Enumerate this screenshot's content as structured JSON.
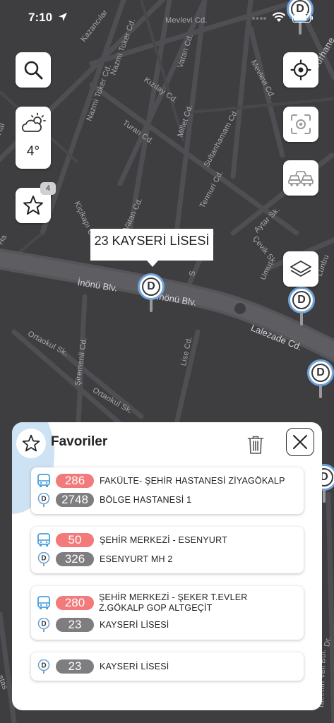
{
  "status_bar": {
    "time": "7:10",
    "icons": [
      "location-arrow-icon",
      "signal-icon",
      "wifi-icon",
      "battery-icon"
    ]
  },
  "map": {
    "streets": [
      "Mevlevi Cd.",
      "Kazancılar",
      "Nazmi Toker Cd.",
      "Nazmi Toker Cd.",
      "Kızılay Cd.",
      "Vatan Cd.",
      "Mevlevi Cd.",
      "Turan Cd.",
      "Millet Cd.",
      "Sultanhamam Cd.",
      "Tennuri Cd.",
      "Kiçikapı Cd.",
      "Vatan Cd.",
      "Aytar Sk.",
      "Çevik Sk.",
      "Umur",
      "Ortaokul Sk.",
      "Şiremenli Cd.",
      "Ortaokul Sk.",
      "Lise Cd.",
      "Tacettin Veli Bul.",
      "Burhane",
      "Hal",
      "Ha",
      "atas",
      "S",
      "Dr.",
      "Lunbu"
    ],
    "main_roads": [
      "İnönü Blv.",
      "İnönü Blv.",
      "Lalezade Cd."
    ],
    "selected_stop_name": "23 KAYSERİ LİSESİ",
    "stop_marker_letter": "D",
    "accent_color": "#6ea3dc"
  },
  "controls": {
    "search_icon": "search-icon",
    "weather": {
      "icon": "partly-cloudy-icon",
      "temperature": "4°"
    },
    "favorites": {
      "icon": "star-icon",
      "count": "4"
    },
    "locate_icon": "crosshair-icon",
    "nearby_icon": "focus-icon",
    "traffic_icon": "cars-icon",
    "layers_icon": "layers-icon"
  },
  "favorites_panel": {
    "title": "Favoriler",
    "items": [
      {
        "kind": "line_and_stop",
        "line_number": "286",
        "line_name": "FAKÜLTE- ŞEHİR HASTANESİ ZİYAGÖKALP",
        "stop_number": "2748",
        "stop_name": "BÖLGE HASTANESİ 1"
      },
      {
        "kind": "line_and_stop",
        "line_number": "50",
        "line_name": "ŞEHİR MERKEZİ - ESENYURT",
        "stop_number": "326",
        "stop_name": "ESENYURT MH 2"
      },
      {
        "kind": "line_and_stop",
        "line_number": "280",
        "line_name_1": "ŞEHİR MERKEZİ - ŞEKER T.EVLER",
        "line_name_2": "Z.GÖKALP GOP ALTGEÇİT",
        "stop_number": "23",
        "stop_name": "KAYSERİ LİSESİ"
      },
      {
        "kind": "stop",
        "stop_number": "23",
        "stop_name": "KAYSERİ LİSESİ"
      }
    ],
    "colors": {
      "line_pill": "#f27a7a",
      "stop_pill": "#7e7e80",
      "bus_icon": "#4a9ee0"
    }
  }
}
